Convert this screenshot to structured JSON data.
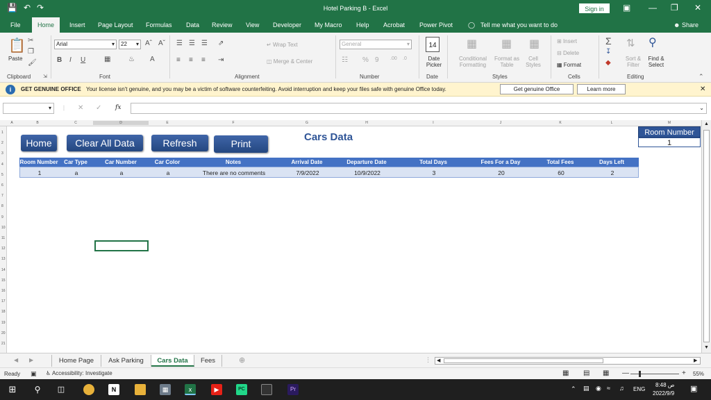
{
  "window": {
    "title": "Hotel Parking B  -  Excel",
    "sign_in": "Sign in",
    "share": "Share"
  },
  "menu": [
    "File",
    "Home",
    "Insert",
    "Page Layout",
    "Formulas",
    "Data",
    "Review",
    "View",
    "Developer",
    "My Macro",
    "Help",
    "Acrobat",
    "Power Pivot"
  ],
  "tell_me": "Tell me what you want to do",
  "ribbon": {
    "paste": "Paste",
    "font_name": "Arial",
    "font_size": "22",
    "wrap_text": "Wrap Text",
    "merge_center": "Merge & Center",
    "number_format": "General",
    "date_picker": "Date Picker",
    "date_num": "14",
    "conditional_formatting": "Conditional Formatting",
    "format_as_table": "Format as Table",
    "cell_styles": "Cell Styles",
    "insert": "Insert",
    "delete": "Delete",
    "format": "Format",
    "sort_filter": "Sort & Filter",
    "find_select": "Find & Select",
    "groups": {
      "clipboard": "Clipboard",
      "font": "Font",
      "alignment": "Alignment",
      "number": "Number",
      "date": "Date",
      "styles": "Styles",
      "cells": "Cells",
      "editing": "Editing"
    }
  },
  "message": {
    "head": "GET GENUINE OFFICE",
    "body": "Your license isn't genuine, and you may be a victim of software counterfeiting. Avoid interruption and keep your files safe with genuine Office today.",
    "btn_genuine": "Get genuine Office",
    "btn_learn": "Learn more"
  },
  "columns": [
    "A",
    "B",
    "C",
    "D",
    "E",
    "F",
    "G",
    "H",
    "I",
    "J",
    "K",
    "L",
    "M"
  ],
  "rows": [
    "1",
    "2",
    "3",
    "4",
    "5",
    "6",
    "7",
    "8",
    "9",
    "10",
    "11",
    "12",
    "13",
    "14",
    "15",
    "16",
    "17",
    "18",
    "19",
    "20",
    "21"
  ],
  "sheet": {
    "buttons": {
      "home": "Home",
      "clear": "Clear All Data",
      "refresh": "Refresh",
      "print": "Print"
    },
    "title": "Cars Data",
    "room_label": "Room Number",
    "room_value": "1",
    "headers": [
      "Room Number",
      "Car Type",
      "Car Number",
      "Car Color",
      "Notes",
      "Arrival Date",
      "Departure Date",
      "Total Days",
      "Fees For a  Day",
      "Total Fees",
      "Days Left"
    ],
    "row": [
      "1",
      "a",
      "a",
      "a",
      "There are no comments",
      "7/9/2022",
      "10/9/2022",
      "3",
      "20",
      "60",
      "2"
    ]
  },
  "tabs": [
    "Home Page",
    "Ask Parking",
    "Cars Data",
    "Fees"
  ],
  "status": {
    "ready": "Ready",
    "accessibility": "Accessibility: Investigate",
    "zoom": "55%"
  },
  "taskbar": {
    "lang": "ENG",
    "time": "8:48 ص",
    "date": "2022/9/9"
  },
  "colors": {
    "excel_green": "#217346",
    "table_blue": "#4472c4",
    "button_blue": "#2f5597"
  }
}
